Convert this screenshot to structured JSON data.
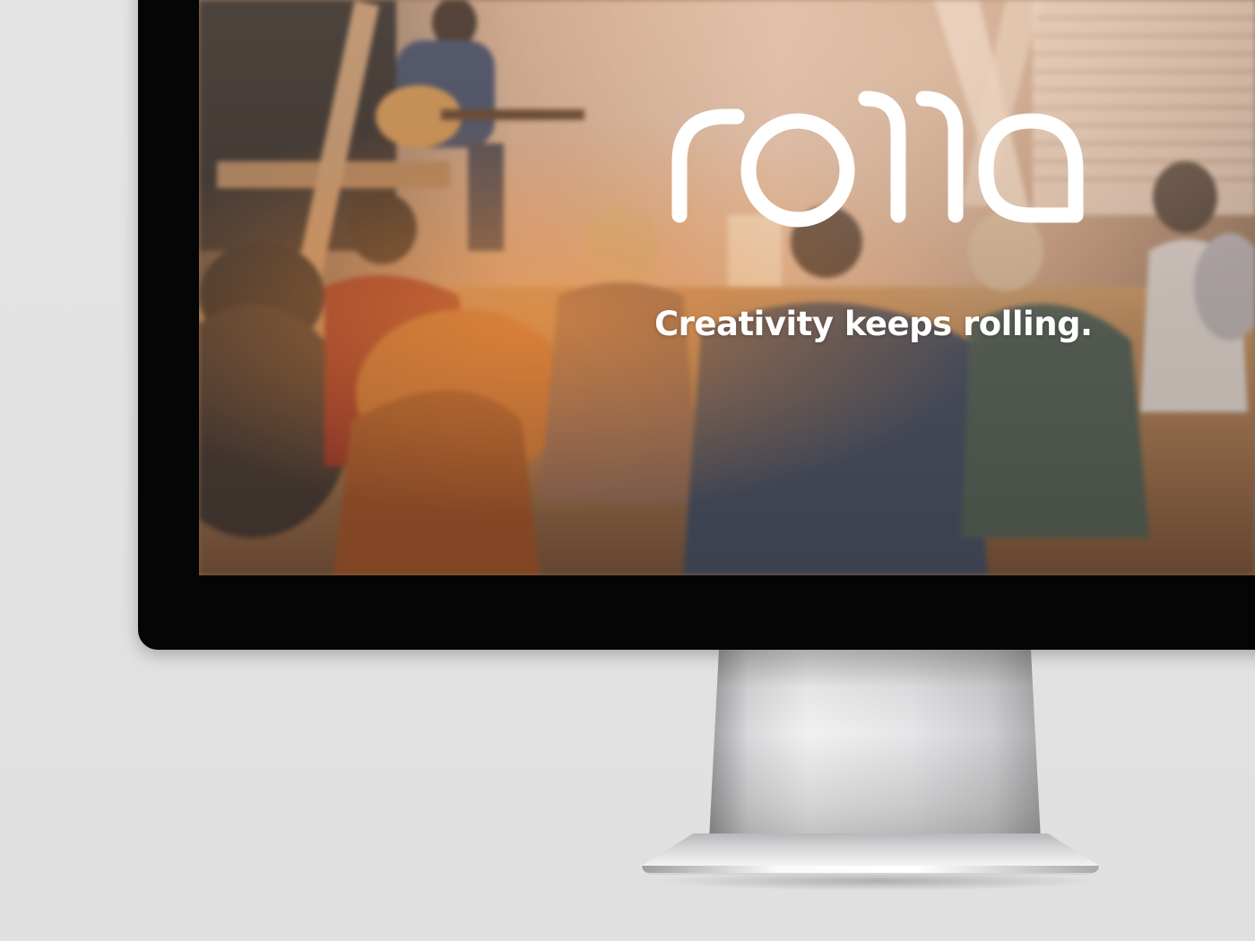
{
  "website": {
    "logo_text": "rolla",
    "tagline": "Creativity keeps rolling."
  },
  "colors": {
    "background": "#e3e3e3",
    "bezel": "#050505",
    "logo": "#ffffff",
    "photo_warm_tone": "#ff9a3c"
  },
  "icons": {
    "logo": "rolla-logo-icon"
  }
}
